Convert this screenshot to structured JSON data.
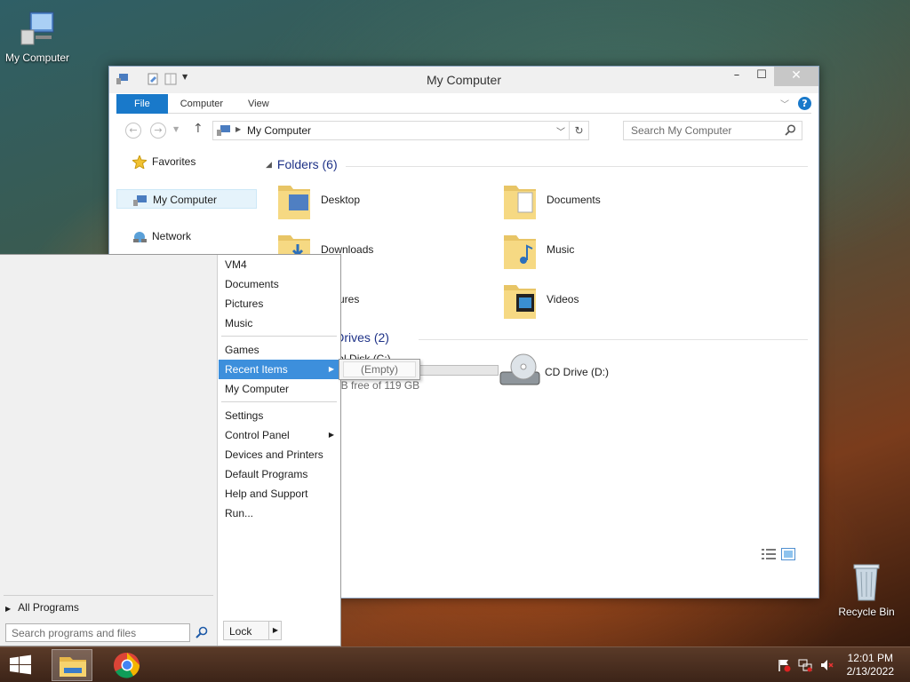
{
  "desktop": {
    "icons": [
      {
        "label": "My Computer"
      },
      {
        "label": "Recycle Bin"
      }
    ]
  },
  "window": {
    "title": "My Computer",
    "ribbon": {
      "file": "File",
      "computer": "Computer",
      "view": "View",
      "help": "?"
    },
    "address": "My Computer",
    "search_placeholder": "Search My Computer",
    "nav": {
      "favorites": "Favorites",
      "my_computer": "My Computer",
      "network": "Network"
    },
    "folders_header": "Folders (6)",
    "folders": [
      "Desktop",
      "Documents",
      "Downloads",
      "Music",
      "Pictures",
      "Videos"
    ],
    "drives_header": "Hard Disk Drives (2)",
    "drives": [
      {
        "label": "Local Disk (C:)",
        "free": "... GB free of 119 GB",
        "used_fraction": 0.1
      },
      {
        "label": "CD Drive (D:)"
      }
    ]
  },
  "start_menu": {
    "right_items": [
      "VM4",
      "Documents",
      "Pictures",
      "Music",
      "Games",
      "Recent Items",
      "My Computer",
      "Settings",
      "Control Panel",
      "Devices and Printers",
      "Default Programs",
      "Help and Support",
      "Run..."
    ],
    "all_programs": "All Programs",
    "search_placeholder": "Search programs and files",
    "lock": "Lock",
    "flyout_empty": "(Empty)"
  },
  "taskbar": {
    "time": "12:01 PM",
    "date": "2/13/2022"
  },
  "colors": {
    "accent": "#1979ca",
    "highlight": "#3d8fdc"
  }
}
